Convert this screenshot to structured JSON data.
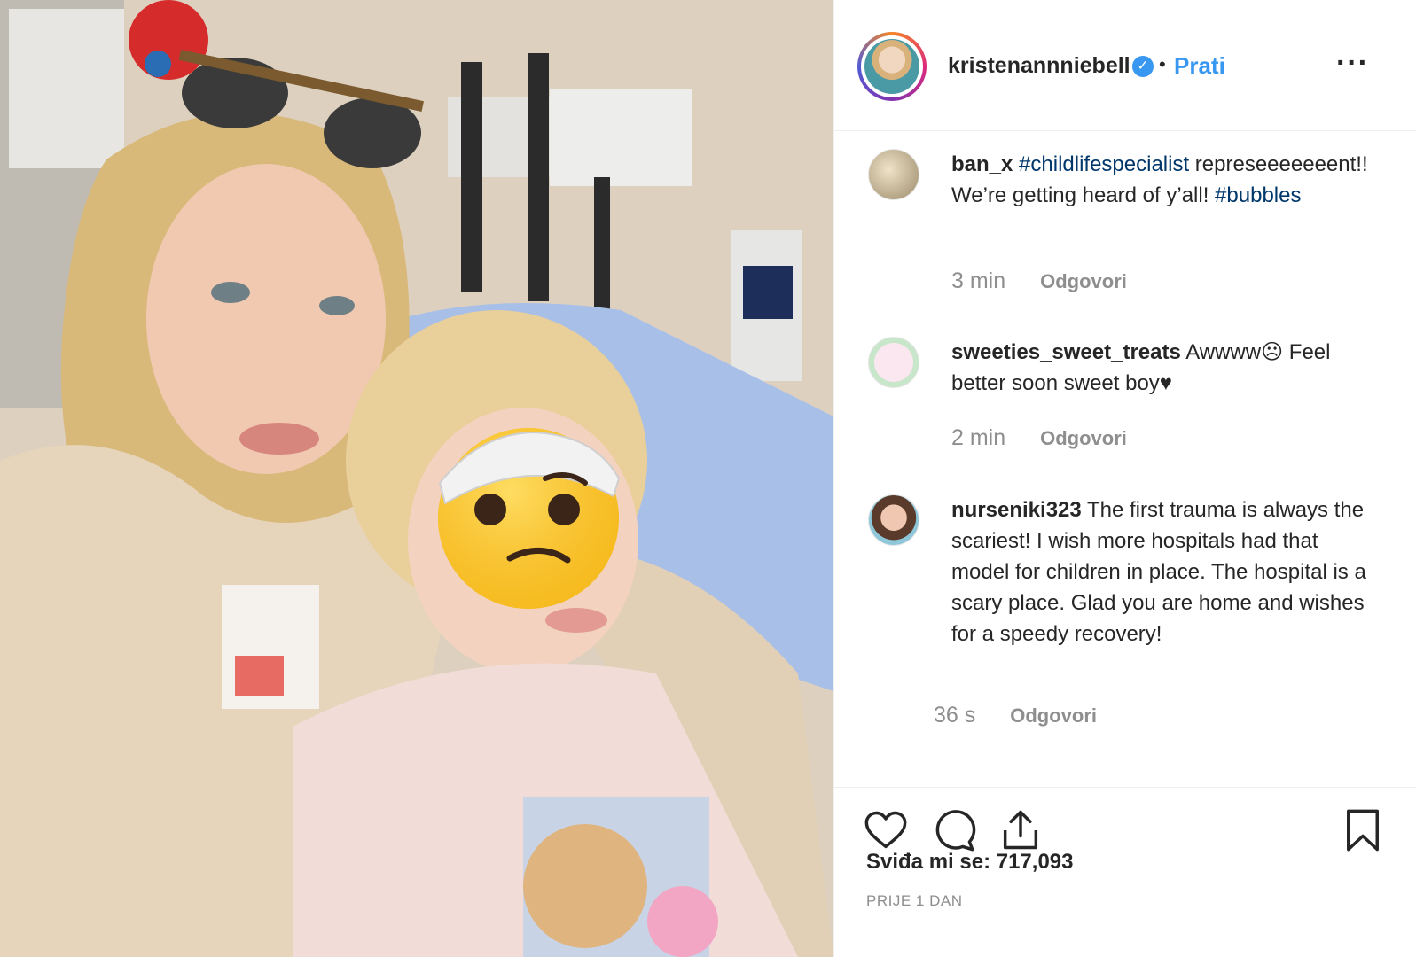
{
  "post": {
    "username": "kristenannniebell",
    "follow_label": "Prati",
    "separator": "•",
    "verified_mark": "✓",
    "more_label": "···",
    "likes_text": "Sviđa mi se: 717,093",
    "time_text": "PRIJE 1 DAN"
  },
  "comments": [
    {
      "user": "ban_x",
      "hashtag1": "#childlifespecialist",
      "text": " represeeeeeeent!! We’re getting heard of y’all! ",
      "hashtag2": "#bubbles",
      "time": "3 min",
      "reply": "Odgovori"
    },
    {
      "user": "sweeties_sweet_treats",
      "text": " Awwww☹ Feel better soon sweet boy♥",
      "time": "2 min",
      "reply": "Odgovori"
    },
    {
      "user": "nurseniki323",
      "text": " The first trauma is always the scariest! I wish more hospitals had that model for children in place. The hospital is a scary place. Glad you are home and wishes for a speedy recovery!",
      "time": "36 s",
      "reply": "Odgovori"
    }
  ],
  "icons": {
    "like": "heart-icon",
    "comment": "comment-bubble-icon",
    "share": "share-icon",
    "save": "bookmark-icon",
    "emoji_overlay": "face-with-head-bandage-emoji"
  },
  "colors": {
    "link_blue": "#3897f0",
    "hashtag_blue": "#00376b",
    "muted_gray": "#8e8e8e",
    "text_dark": "#262626"
  }
}
